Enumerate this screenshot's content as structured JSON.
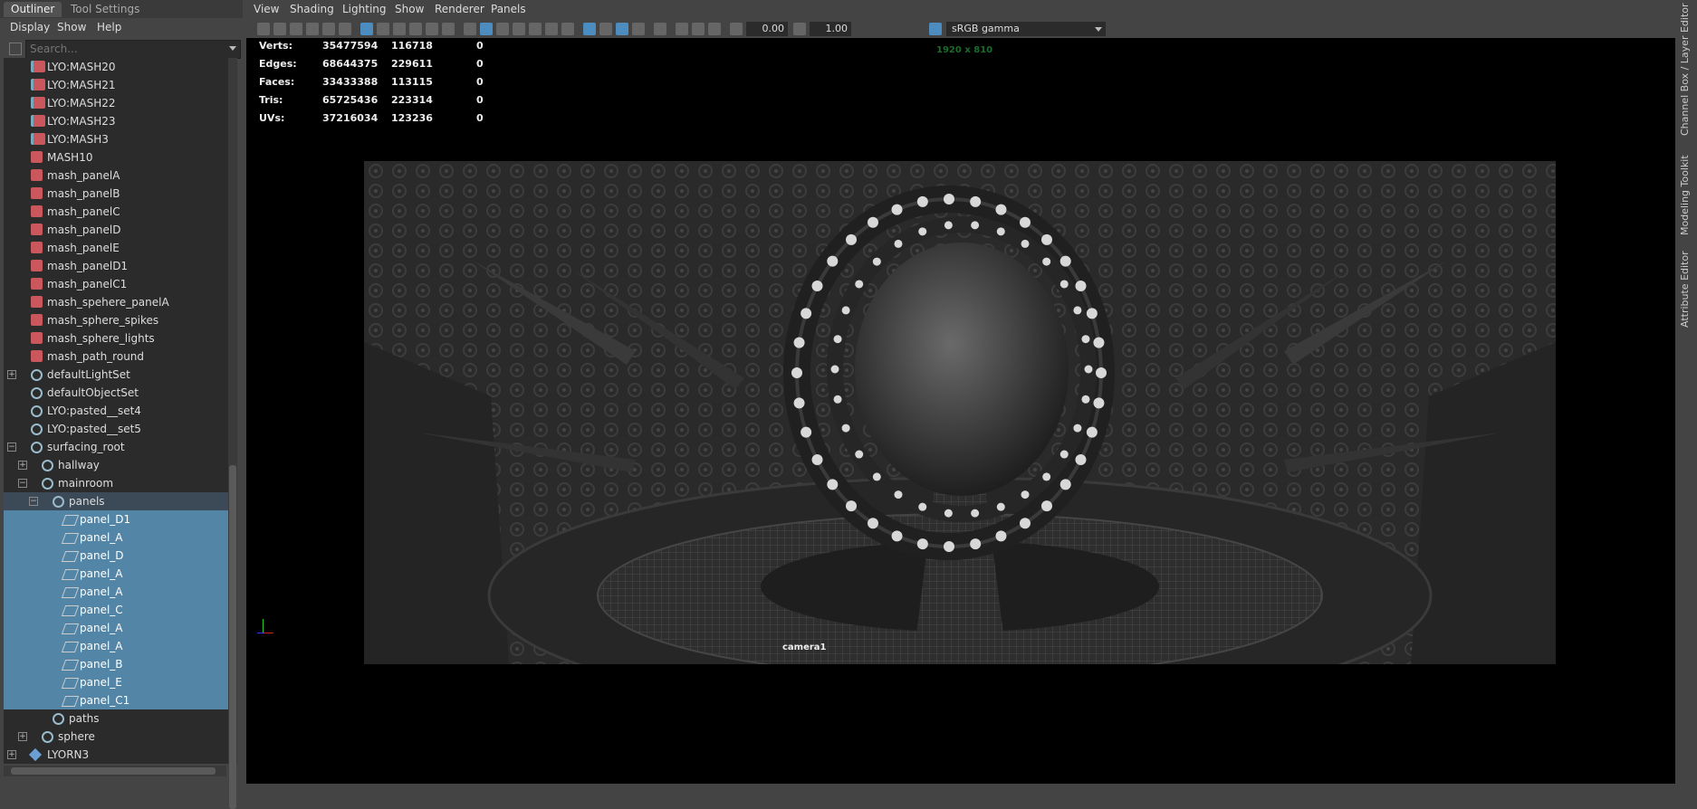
{
  "outliner": {
    "tabs": [
      "Outliner",
      "Tool Settings"
    ],
    "menu": [
      "Display",
      "Show",
      "Help"
    ],
    "search_placeholder": "Search...",
    "rows": [
      {
        "label": "LYO:MASH20",
        "icon": "mash-lyo-icon",
        "depth": 0,
        "state": ""
      },
      {
        "label": "LYO:MASH21",
        "icon": "mash-lyo-icon",
        "depth": 0,
        "state": ""
      },
      {
        "label": "LYO:MASH22",
        "icon": "mash-lyo-icon",
        "depth": 0,
        "state": ""
      },
      {
        "label": "LYO:MASH23",
        "icon": "mash-lyo-icon",
        "depth": 0,
        "state": ""
      },
      {
        "label": "LYO:MASH3",
        "icon": "mash-lyo-icon",
        "depth": 0,
        "state": ""
      },
      {
        "label": "MASH10",
        "icon": "mash-icon",
        "depth": 0,
        "state": ""
      },
      {
        "label": "mash_panelA",
        "icon": "mash-icon",
        "depth": 0,
        "state": ""
      },
      {
        "label": "mash_panelB",
        "icon": "mash-icon",
        "depth": 0,
        "state": ""
      },
      {
        "label": "mash_panelC",
        "icon": "mash-icon",
        "depth": 0,
        "state": ""
      },
      {
        "label": "mash_panelD",
        "icon": "mash-icon",
        "depth": 0,
        "state": ""
      },
      {
        "label": "mash_panelE",
        "icon": "mash-icon",
        "depth": 0,
        "state": ""
      },
      {
        "label": "mash_panelD1",
        "icon": "mash-icon",
        "depth": 0,
        "state": ""
      },
      {
        "label": "mash_panelC1",
        "icon": "mash-icon",
        "depth": 0,
        "state": ""
      },
      {
        "label": "mash_spehere_panelA",
        "icon": "mash-icon",
        "depth": 0,
        "state": ""
      },
      {
        "label": "mash_sphere_spikes",
        "icon": "mash-icon",
        "depth": 0,
        "state": ""
      },
      {
        "label": "mash_sphere_lights",
        "icon": "mash-icon",
        "depth": 0,
        "state": ""
      },
      {
        "label": "mash_path_round",
        "icon": "mash-icon",
        "depth": 0,
        "state": ""
      },
      {
        "label": "defaultLightSet",
        "icon": "set-icon",
        "depth": 0,
        "state": "",
        "expander": "+"
      },
      {
        "label": "defaultObjectSet",
        "icon": "set-icon",
        "depth": 0,
        "state": ""
      },
      {
        "label": "LYO:pasted__set4",
        "icon": "set-icon",
        "depth": 0,
        "state": ""
      },
      {
        "label": "LYO:pasted__set5",
        "icon": "set-icon",
        "depth": 0,
        "state": ""
      },
      {
        "label": "surfacing_root",
        "icon": "set-icon",
        "depth": 0,
        "state": "",
        "expander": "−"
      },
      {
        "label": "hallway",
        "icon": "set-icon",
        "depth": 1,
        "state": "",
        "expander": "+"
      },
      {
        "label": "mainroom",
        "icon": "set-icon",
        "depth": 1,
        "state": "",
        "expander": "−"
      },
      {
        "label": "panels",
        "icon": "set-icon",
        "depth": 2,
        "state": "hl",
        "expander": "−"
      },
      {
        "label": "panel_D1",
        "icon": "mesh-icon",
        "depth": 3,
        "state": "sel"
      },
      {
        "label": "panel_A",
        "icon": "mesh-icon",
        "depth": 3,
        "state": "sel"
      },
      {
        "label": "panel_D",
        "icon": "mesh-icon",
        "depth": 3,
        "state": "sel"
      },
      {
        "label": "panel_A",
        "icon": "mesh-icon",
        "depth": 3,
        "state": "sel"
      },
      {
        "label": "panel_A",
        "icon": "mesh-icon",
        "depth": 3,
        "state": "sel"
      },
      {
        "label": "panel_C",
        "icon": "mesh-icon",
        "depth": 3,
        "state": "sel"
      },
      {
        "label": "panel_A",
        "icon": "mesh-icon",
        "depth": 3,
        "state": "sel"
      },
      {
        "label": "panel_A",
        "icon": "mesh-icon",
        "depth": 3,
        "state": "sel"
      },
      {
        "label": "panel_B",
        "icon": "mesh-icon",
        "depth": 3,
        "state": "sel"
      },
      {
        "label": "panel_E",
        "icon": "mesh-icon",
        "depth": 3,
        "state": "sel"
      },
      {
        "label": "panel_C1",
        "icon": "mesh-icon",
        "depth": 3,
        "state": "sel"
      },
      {
        "label": "paths",
        "icon": "set-icon",
        "depth": 2,
        "state": ""
      },
      {
        "label": "sphere",
        "icon": "set-icon",
        "depth": 1,
        "state": "",
        "expander": "+"
      },
      {
        "label": "LYORN3",
        "icon": "lyorn-icon",
        "depth": 0,
        "state": "",
        "expander": "+"
      }
    ]
  },
  "viewport": {
    "menu": [
      "View",
      "Shading",
      "Lighting",
      "Show",
      "Renderer",
      "Panels"
    ],
    "exposure": "0.00",
    "gamma_value": "1.00",
    "color_space": "sRGB gamma",
    "resolution": "1920 x 810",
    "camera": "camera1",
    "stats": [
      {
        "label": "Verts:",
        "total": "35477594",
        "selected": "116718",
        "extra": "0"
      },
      {
        "label": "Edges:",
        "total": "68644375",
        "selected": "229611",
        "extra": "0"
      },
      {
        "label": "Faces:",
        "total": "33433388",
        "selected": "113115",
        "extra": "0"
      },
      {
        "label": "Tris:",
        "total": "65725436",
        "selected": "223314",
        "extra": "0"
      },
      {
        "label": "UVs:",
        "total": "37216034",
        "selected": "123236",
        "extra": "0"
      }
    ]
  },
  "side_tabs": [
    "Channel Box / Layer Editor",
    "Modeling Toolkit",
    "Attribute Editor"
  ]
}
